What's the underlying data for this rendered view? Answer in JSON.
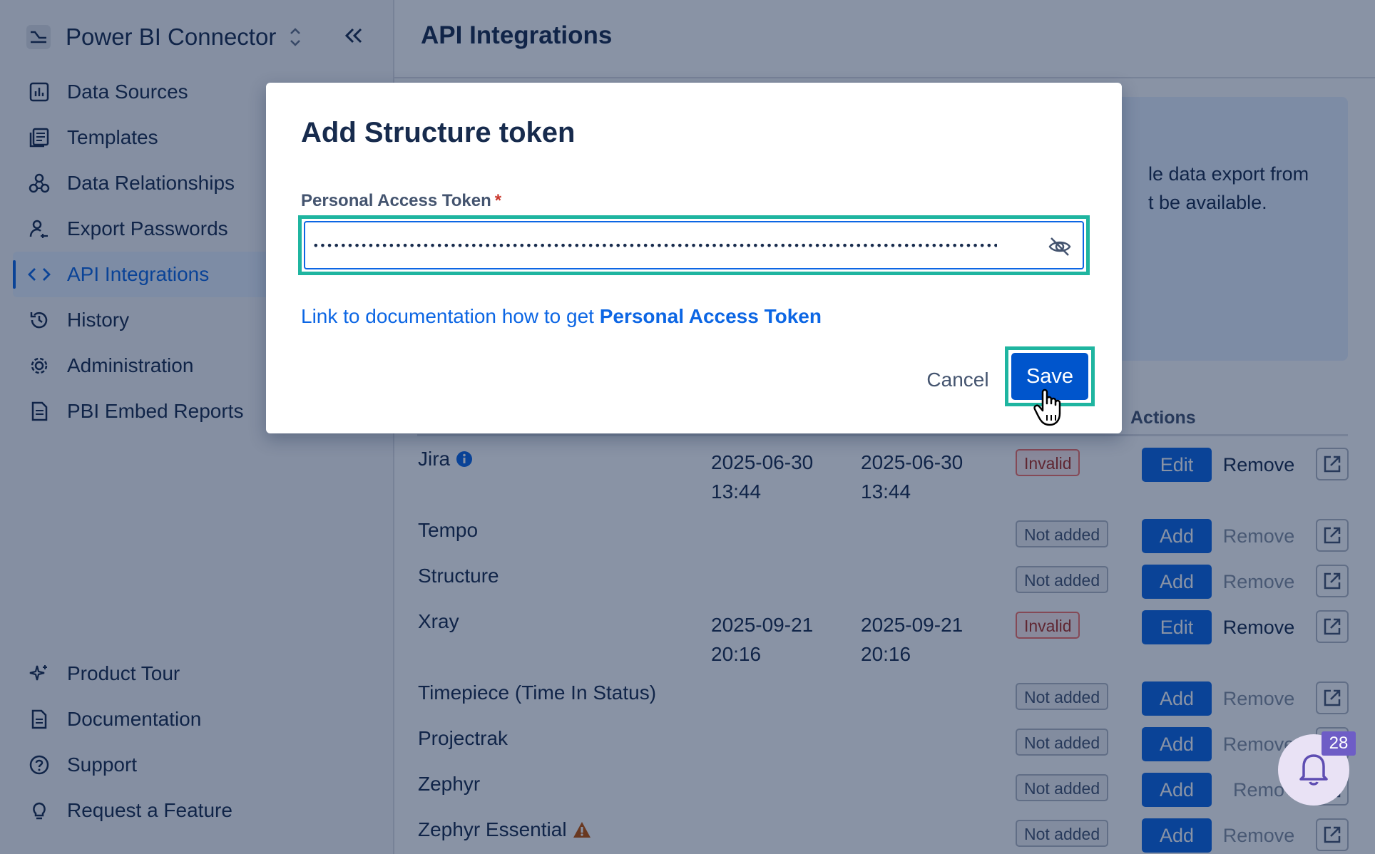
{
  "app": {
    "name": "Power BI Connector"
  },
  "sidebar": {
    "items": [
      {
        "label": "Data Sources",
        "icon": "bar-chart-icon"
      },
      {
        "label": "Templates",
        "icon": "templates-icon"
      },
      {
        "label": "Data Relationships",
        "icon": "relationships-icon"
      },
      {
        "label": "Export Passwords",
        "icon": "user-key-icon"
      },
      {
        "label": "API Integrations",
        "icon": "code-icon",
        "active": true
      },
      {
        "label": "History",
        "icon": "history-icon"
      },
      {
        "label": "Administration",
        "icon": "gear-icon"
      },
      {
        "label": "PBI Embed Reports",
        "icon": "document-icon"
      }
    ],
    "bottom_items": [
      {
        "label": "Product Tour",
        "icon": "sparkle-icon"
      },
      {
        "label": "Documentation",
        "icon": "doc-icon"
      },
      {
        "label": "Support",
        "icon": "help-icon"
      },
      {
        "label": "Request a Feature",
        "icon": "lightbulb-icon"
      }
    ]
  },
  "main": {
    "title": "API Integrations",
    "info_text_line1": "le data export from",
    "info_text_line2": "t be available.",
    "table": {
      "actions_header": "Actions",
      "rows": [
        {
          "name": "Jira",
          "has_info_icon": true,
          "date1_day": "2025-06-30",
          "date1_time": "13:44",
          "date2_day": "2025-06-30",
          "date2_time": "13:44",
          "status": "Invalid",
          "primary": "Edit",
          "remove": "Remove",
          "remove_enabled": true
        },
        {
          "name": "Tempo",
          "status": "Not added",
          "primary": "Add",
          "remove": "Remove",
          "remove_enabled": false
        },
        {
          "name": "Structure",
          "status": "Not added",
          "primary": "Add",
          "remove": "Remove",
          "remove_enabled": false
        },
        {
          "name": "Xray",
          "date1_day": "2025-09-21",
          "date1_time": "20:16",
          "date2_day": "2025-09-21",
          "date2_time": "20:16",
          "status": "Invalid",
          "primary": "Edit",
          "remove": "Remove",
          "remove_enabled": true
        },
        {
          "name": "Timepiece (Time In Status)",
          "status": "Not added",
          "primary": "Add",
          "remove": "Remove",
          "remove_enabled": false
        },
        {
          "name": "Projectrak",
          "status": "Not added",
          "primary": "Add",
          "remove": "Remove",
          "remove_enabled": false
        },
        {
          "name": "Zephyr",
          "status": "Not added",
          "primary": "Add",
          "remove": "Remo",
          "remove_enabled": false
        },
        {
          "name": "Zephyr Essential",
          "has_warning_icon": true,
          "status": "Not added",
          "primary": "Add",
          "remove": "Remove",
          "remove_enabled": false
        }
      ]
    }
  },
  "modal": {
    "title": "Add Structure token",
    "field_label": "Personal Access Token",
    "required_mark": "*",
    "token_value": "••••••••••••••••••••••••••••••••••••••••••••••••••••••••••••••••••••••••••••••••••••••••••••••••••••••",
    "doc_link_prefix": "Link to documentation how to get ",
    "doc_link_bold": "Personal Access Token",
    "cancel_label": "Cancel",
    "save_label": "Save"
  },
  "notifications": {
    "count": "28"
  },
  "colors": {
    "accent": "#0c66e4",
    "highlight": "#1fb5a0",
    "invalid": "#ae2e24"
  }
}
